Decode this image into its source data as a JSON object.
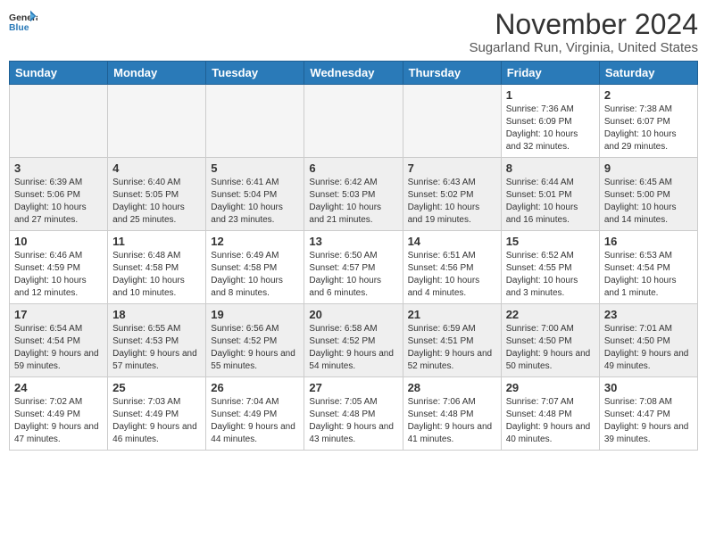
{
  "logo": {
    "general": "General",
    "blue": "Blue"
  },
  "header": {
    "month": "November 2024",
    "location": "Sugarland Run, Virginia, United States"
  },
  "weekdays": [
    "Sunday",
    "Monday",
    "Tuesday",
    "Wednesday",
    "Thursday",
    "Friday",
    "Saturday"
  ],
  "weeks": [
    [
      {
        "day": "",
        "info": ""
      },
      {
        "day": "",
        "info": ""
      },
      {
        "day": "",
        "info": ""
      },
      {
        "day": "",
        "info": ""
      },
      {
        "day": "",
        "info": ""
      },
      {
        "day": "1",
        "info": "Sunrise: 7:36 AM\nSunset: 6:09 PM\nDaylight: 10 hours and 32 minutes."
      },
      {
        "day": "2",
        "info": "Sunrise: 7:38 AM\nSunset: 6:07 PM\nDaylight: 10 hours and 29 minutes."
      }
    ],
    [
      {
        "day": "3",
        "info": "Sunrise: 6:39 AM\nSunset: 5:06 PM\nDaylight: 10 hours and 27 minutes."
      },
      {
        "day": "4",
        "info": "Sunrise: 6:40 AM\nSunset: 5:05 PM\nDaylight: 10 hours and 25 minutes."
      },
      {
        "day": "5",
        "info": "Sunrise: 6:41 AM\nSunset: 5:04 PM\nDaylight: 10 hours and 23 minutes."
      },
      {
        "day": "6",
        "info": "Sunrise: 6:42 AM\nSunset: 5:03 PM\nDaylight: 10 hours and 21 minutes."
      },
      {
        "day": "7",
        "info": "Sunrise: 6:43 AM\nSunset: 5:02 PM\nDaylight: 10 hours and 19 minutes."
      },
      {
        "day": "8",
        "info": "Sunrise: 6:44 AM\nSunset: 5:01 PM\nDaylight: 10 hours and 16 minutes."
      },
      {
        "day": "9",
        "info": "Sunrise: 6:45 AM\nSunset: 5:00 PM\nDaylight: 10 hours and 14 minutes."
      }
    ],
    [
      {
        "day": "10",
        "info": "Sunrise: 6:46 AM\nSunset: 4:59 PM\nDaylight: 10 hours and 12 minutes."
      },
      {
        "day": "11",
        "info": "Sunrise: 6:48 AM\nSunset: 4:58 PM\nDaylight: 10 hours and 10 minutes."
      },
      {
        "day": "12",
        "info": "Sunrise: 6:49 AM\nSunset: 4:58 PM\nDaylight: 10 hours and 8 minutes."
      },
      {
        "day": "13",
        "info": "Sunrise: 6:50 AM\nSunset: 4:57 PM\nDaylight: 10 hours and 6 minutes."
      },
      {
        "day": "14",
        "info": "Sunrise: 6:51 AM\nSunset: 4:56 PM\nDaylight: 10 hours and 4 minutes."
      },
      {
        "day": "15",
        "info": "Sunrise: 6:52 AM\nSunset: 4:55 PM\nDaylight: 10 hours and 3 minutes."
      },
      {
        "day": "16",
        "info": "Sunrise: 6:53 AM\nSunset: 4:54 PM\nDaylight: 10 hours and 1 minute."
      }
    ],
    [
      {
        "day": "17",
        "info": "Sunrise: 6:54 AM\nSunset: 4:54 PM\nDaylight: 9 hours and 59 minutes."
      },
      {
        "day": "18",
        "info": "Sunrise: 6:55 AM\nSunset: 4:53 PM\nDaylight: 9 hours and 57 minutes."
      },
      {
        "day": "19",
        "info": "Sunrise: 6:56 AM\nSunset: 4:52 PM\nDaylight: 9 hours and 55 minutes."
      },
      {
        "day": "20",
        "info": "Sunrise: 6:58 AM\nSunset: 4:52 PM\nDaylight: 9 hours and 54 minutes."
      },
      {
        "day": "21",
        "info": "Sunrise: 6:59 AM\nSunset: 4:51 PM\nDaylight: 9 hours and 52 minutes."
      },
      {
        "day": "22",
        "info": "Sunrise: 7:00 AM\nSunset: 4:50 PM\nDaylight: 9 hours and 50 minutes."
      },
      {
        "day": "23",
        "info": "Sunrise: 7:01 AM\nSunset: 4:50 PM\nDaylight: 9 hours and 49 minutes."
      }
    ],
    [
      {
        "day": "24",
        "info": "Sunrise: 7:02 AM\nSunset: 4:49 PM\nDaylight: 9 hours and 47 minutes."
      },
      {
        "day": "25",
        "info": "Sunrise: 7:03 AM\nSunset: 4:49 PM\nDaylight: 9 hours and 46 minutes."
      },
      {
        "day": "26",
        "info": "Sunrise: 7:04 AM\nSunset: 4:49 PM\nDaylight: 9 hours and 44 minutes."
      },
      {
        "day": "27",
        "info": "Sunrise: 7:05 AM\nSunset: 4:48 PM\nDaylight: 9 hours and 43 minutes."
      },
      {
        "day": "28",
        "info": "Sunrise: 7:06 AM\nSunset: 4:48 PM\nDaylight: 9 hours and 41 minutes."
      },
      {
        "day": "29",
        "info": "Sunrise: 7:07 AM\nSunset: 4:48 PM\nDaylight: 9 hours and 40 minutes."
      },
      {
        "day": "30",
        "info": "Sunrise: 7:08 AM\nSunset: 4:47 PM\nDaylight: 9 hours and 39 minutes."
      }
    ]
  ]
}
